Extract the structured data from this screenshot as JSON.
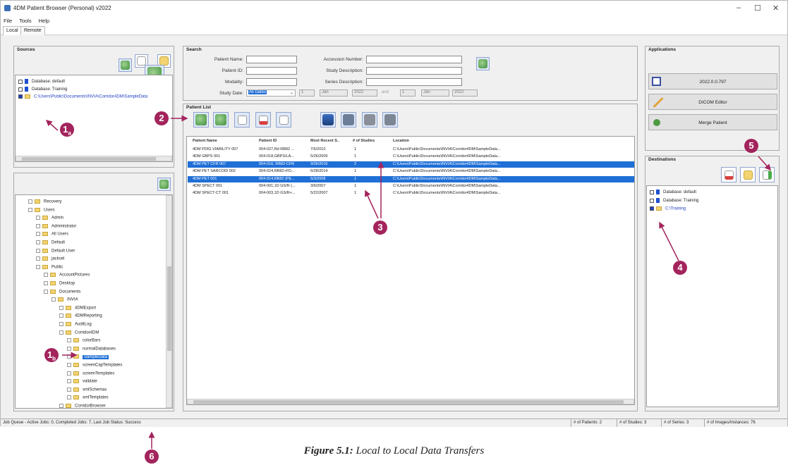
{
  "window": {
    "title": "4DM Patient Browser (Personal) v2022",
    "minimize": "–",
    "maximize": "☐",
    "close": "✕"
  },
  "menu": [
    "File",
    "Tools",
    "Help"
  ],
  "tabs": [
    "Local",
    "Remote"
  ],
  "sources": {
    "title": "Sources",
    "items": [
      {
        "label": "Database: default",
        "checked": false,
        "kind": "database"
      },
      {
        "label": "Database: Training",
        "checked": false,
        "kind": "database"
      },
      {
        "label": "C:\\Users\\Public\\Documents\\INVIA\\Corridor4DM\\SampleData",
        "checked": true,
        "kind": "folder"
      }
    ]
  },
  "tree": [
    {
      "label": "Recovery",
      "level": 1
    },
    {
      "label": "Users",
      "level": 1
    },
    {
      "label": "Admin",
      "level": 2
    },
    {
      "label": "Administrator",
      "level": 2
    },
    {
      "label": "All Users",
      "level": 2
    },
    {
      "label": "Default",
      "level": 2
    },
    {
      "label": "Default User",
      "level": 2
    },
    {
      "label": "jacksel",
      "level": 2
    },
    {
      "label": "Public",
      "level": 2
    },
    {
      "label": "AccountPictures",
      "level": 3
    },
    {
      "label": "Desktop",
      "level": 3
    },
    {
      "label": "Documents",
      "level": 3
    },
    {
      "label": "INVIA",
      "level": 4
    },
    {
      "label": "4DMExport",
      "level": 5
    },
    {
      "label": "4DMReporting",
      "level": 5
    },
    {
      "label": "AuditLog",
      "level": 5
    },
    {
      "label": "Corridor4DM",
      "level": 5
    },
    {
      "label": "colorBars",
      "level": 6
    },
    {
      "label": "normalDatabases",
      "level": 6
    },
    {
      "label": "SampleData",
      "level": 6,
      "selected": true
    },
    {
      "label": "screenCapTemplates",
      "level": 6
    },
    {
      "label": "screenTemplates",
      "level": 6
    },
    {
      "label": "validate",
      "level": 6
    },
    {
      "label": "xmlSchemas",
      "level": 6
    },
    {
      "label": "xmlTemplates",
      "level": 6
    },
    {
      "label": "CorridorBrowser",
      "level": 5
    }
  ],
  "search": {
    "title": "Search",
    "patient_name": "Patient Name:",
    "patient_id": "Patient ID:",
    "modality": "Modality:",
    "study_date": "Study Date:",
    "study_date_value": "All Dates",
    "accession": "Accession Number:",
    "study_desc": "Study Description:",
    "series_desc": "Series Description:",
    "d1": "1",
    "m1": "Jan",
    "y1": "2022",
    "and": "and",
    "d2": "1",
    "m2": "Jan",
    "y2": "2022"
  },
  "patient_list": {
    "title": "Patient List",
    "columns": [
      "Patient Name",
      "Patient ID",
      "Most Recent S..",
      "# of Studies",
      "Location"
    ],
    "rows": [
      {
        "name": "4DM PDIG VIABILITY 007",
        "id": "004-027,Rd RB82 ...",
        "date": "7/6/2010",
        "studies": "1",
        "loc": "C:\\Users\\Public\\Documents\\INVIA\\Corridor4DM\\SampleData...",
        "sel": false
      },
      {
        "name": "4DM GBPS 001",
        "id": "004-018,GBPS/LA...",
        "date": "5/26/2009",
        "studies": "1",
        "loc": "C:\\Users\\Public\\Documents\\INVIA\\Corridor4DM\\SampleData...",
        "sel": false
      },
      {
        "name": "4DM PET CFR 007",
        "id": "004-016, RB82-CFR",
        "date": "9/26/2016",
        "studies": "2",
        "loc": "C:\\Users\\Public\\Documents\\INVIA\\Corridor4DM\\SampleData...",
        "sel": true
      },
      {
        "name": "4DM PET SARCOID 002",
        "id": "004-024,RB82+FD...",
        "date": "6/28/2014",
        "studies": "1",
        "loc": "C:\\Users\\Public\\Documents\\INVIA\\Corridor4DM\\SampleData...",
        "sel": false
      },
      {
        "name": "4DM PET 001",
        "id": "004-014,RB82 (PE...",
        "date": "5/3/2008",
        "studies": "1",
        "loc": "C:\\Users\\Public\\Documents\\INVIA\\Corridor4DM\\SampleData...",
        "sel": true
      },
      {
        "name": "4DM SPECT 001",
        "id": "004-001,1D GS/R (...",
        "date": "3/6/2007",
        "studies": "1",
        "loc": "C:\\Users\\Public\\Documents\\INVIA\\Corridor4DM\\SampleData...",
        "sel": false
      },
      {
        "name": "4DM SPECT-CT 001",
        "id": "004-003,1D GS/R+...",
        "date": "5/22/2007",
        "studies": "1",
        "loc": "C:\\Users\\Public\\Documents\\INVIA\\Corridor4DM\\SampleData...",
        "sel": false
      }
    ]
  },
  "applications": {
    "title": "Applications",
    "buttons": [
      "2022.0.0.797",
      "DICOM Editor",
      "Merge Patient"
    ]
  },
  "destinations": {
    "title": "Destinations",
    "items": [
      {
        "label": "Database: default",
        "checked": false,
        "kind": "database"
      },
      {
        "label": "Database: Training",
        "checked": false,
        "kind": "database"
      },
      {
        "label": "C:\\Training",
        "checked": true,
        "kind": "folder"
      }
    ]
  },
  "status": {
    "jobs": "Job Queue - Active Jobs: 0, Completed Jobs: 7, Last Job Status: Success",
    "patients": "# of Patients: 2",
    "studies": "# of Studies: 3",
    "series": "# of Series: 3",
    "images": "# of Images/Instances: 76"
  },
  "callouts": {
    "c1a_num": "1",
    "c1a_sub": "a",
    "c1b_num": "1",
    "c1b_sub": "b",
    "c2": "2",
    "c3": "3",
    "c4": "4",
    "c5": "5",
    "c6": "6"
  },
  "caption": {
    "prefix": "Figure 5.1:",
    "text": " Local to Local Data Transfers"
  },
  "colors": {
    "accent": "#1f6fd6",
    "callout": "#a3245d"
  }
}
